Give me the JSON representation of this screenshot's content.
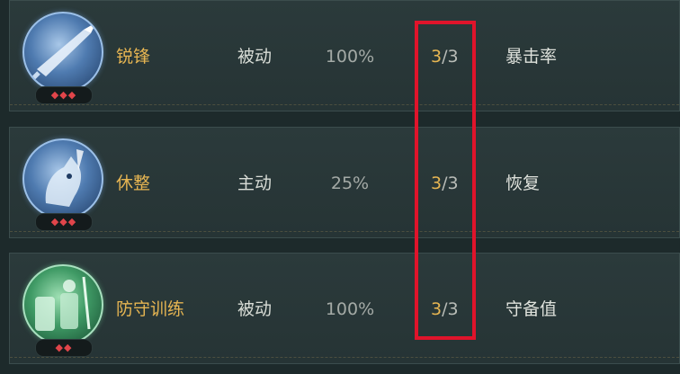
{
  "skills": [
    {
      "name": "锐锋",
      "type": "被动",
      "rate": "100%",
      "level_current": "3",
      "level_max": "/3",
      "stat": "暴击率",
      "stars": "◆◆◆",
      "icon": "blade-icon"
    },
    {
      "name": "休整",
      "type": "主动",
      "rate": "25%",
      "level_current": "3",
      "level_max": "/3",
      "stat": "恢复",
      "stars": "◆◆◆",
      "icon": "horse-rest-icon"
    },
    {
      "name": "防守训练",
      "type": "被动",
      "rate": "100%",
      "level_current": "3",
      "level_max": "/3",
      "stat": "守备值",
      "stars": "◆◆",
      "icon": "shield-soldiers-icon"
    }
  ],
  "colors": {
    "name": "#e6b552",
    "highlight": "#e0142b",
    "star": "#e0454a"
  }
}
